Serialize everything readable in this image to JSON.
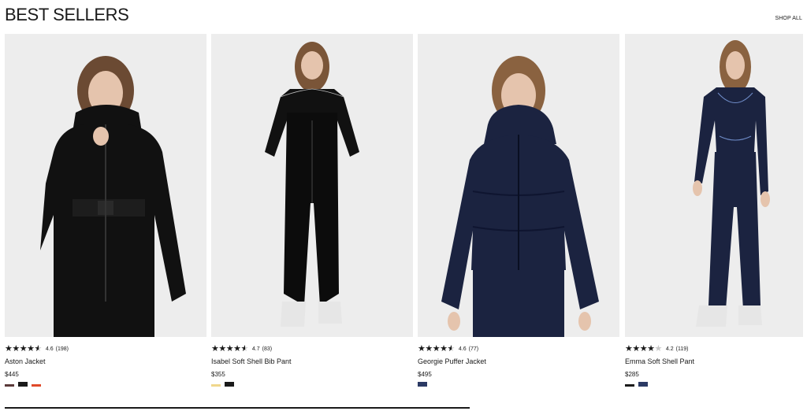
{
  "header": {
    "title": "BEST SELLERS",
    "shop_all": "SHOP ALL"
  },
  "products": [
    {
      "name": "Aston Jacket",
      "price": "$445",
      "rating": "4.6",
      "rating_value": 4.6,
      "reviews": "(198)",
      "swatches": [
        "#5a3a3a",
        "#1a1a1a",
        "#e04a2a"
      ]
    },
    {
      "name": "Isabel Soft Shell Bib Pant",
      "price": "$355",
      "rating": "4.7",
      "rating_value": 4.7,
      "reviews": "(83)",
      "swatches": [
        "#f0d78c",
        "#1a1a1a"
      ]
    },
    {
      "name": "Georgie Puffer Jacket",
      "price": "$495",
      "rating": "4.6",
      "rating_value": 4.6,
      "reviews": "(77)",
      "swatches": [
        "#2b3a64"
      ]
    },
    {
      "name": "Emma Soft Shell Pant",
      "price": "$285",
      "rating": "4.2",
      "rating_value": 4.2,
      "reviews": "(119)",
      "swatches": [
        "#1a1a1a",
        "#2b3a64"
      ]
    }
  ],
  "colors": {
    "text": "#1a1a1a",
    "image_bg": "#ededed",
    "black_garment": "#111111",
    "navy_garment": "#1b2340"
  }
}
